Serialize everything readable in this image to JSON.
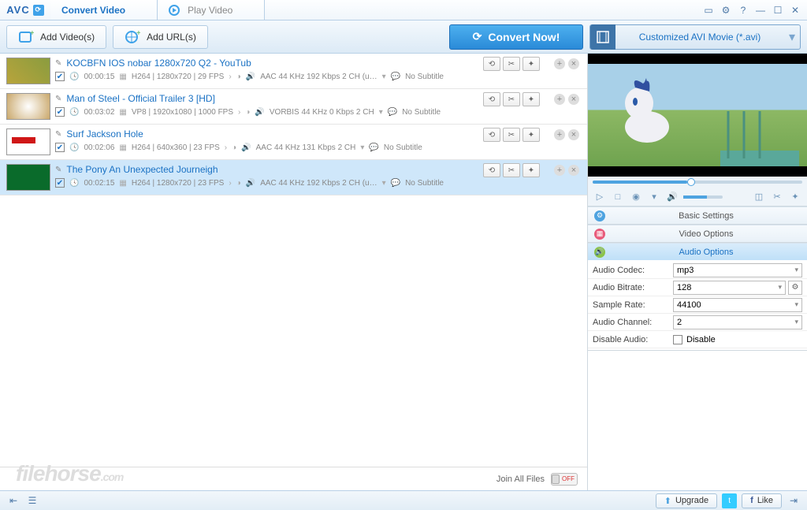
{
  "app": {
    "logo": "AVC"
  },
  "tabs": {
    "convert": "Convert Video",
    "play": "Play Video"
  },
  "toolbar": {
    "add_videos": "Add Video(s)",
    "add_urls": "Add URL(s)",
    "convert_now": "Convert Now!",
    "profile": "Customized AVI Movie (*.avi)"
  },
  "videos": [
    {
      "title": "KOCBFN IOS nobar 1280x720 Q2 - YouTub",
      "duration": "00:00:15",
      "vcodec": "H264 | 1280x720 | 29 FPS",
      "acodec": "AAC 44 KHz 192 Kbps 2 CH (u…",
      "subtitle": "No Subtitle",
      "checked": true
    },
    {
      "title": "Man of Steel - Official Trailer 3 [HD]",
      "duration": "00:03:02",
      "vcodec": "VP8 | 1920x1080 | 1000 FPS",
      "acodec": "VORBIS 44 KHz 0 Kbps 2 CH",
      "subtitle": "No Subtitle",
      "checked": true
    },
    {
      "title": "Surf Jackson Hole",
      "duration": "00:02:06",
      "vcodec": "H264 | 640x360 | 23 FPS",
      "acodec": "AAC 44 KHz 131 Kbps 2 CH",
      "subtitle": "No Subtitle",
      "checked": true
    },
    {
      "title": "The Pony An Unexpected Journeigh",
      "duration": "00:02:15",
      "vcodec": "H264 | 1280x720 | 23 FPS",
      "acodec": "AAC 44 KHz 192 Kbps 2 CH (u…",
      "subtitle": "No Subtitle",
      "checked": true,
      "selected": true
    }
  ],
  "list_footer": {
    "join": "Join All Files",
    "toggle": "OFF"
  },
  "settings": {
    "basic": "Basic Settings",
    "video": "Video Options",
    "audio": "Audio Options",
    "rows": {
      "codec_label": "Audio Codec:",
      "codec_value": "mp3",
      "bitrate_label": "Audio Bitrate:",
      "bitrate_value": "128",
      "sample_label": "Sample Rate:",
      "sample_value": "44100",
      "channel_label": "Audio Channel:",
      "channel_value": "2",
      "disable_label": "Disable Audio:",
      "disable_value": "Disable"
    }
  },
  "bottom": {
    "upgrade": "Upgrade",
    "like": "Like"
  },
  "watermark": {
    "main": "filehorse",
    "sub": ".com"
  }
}
